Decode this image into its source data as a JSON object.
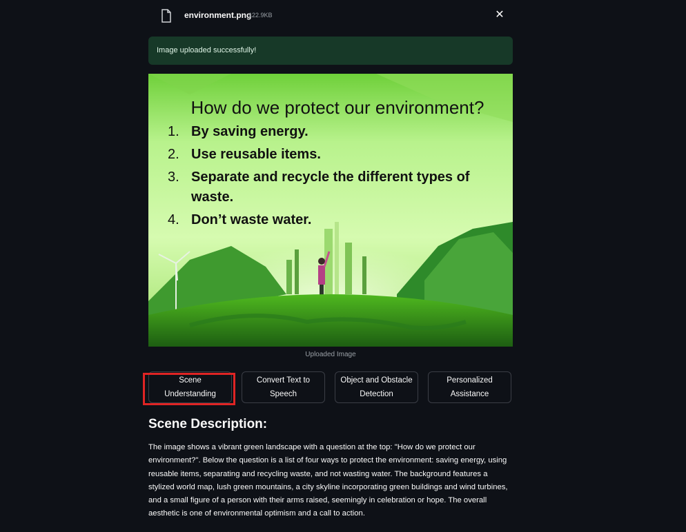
{
  "file": {
    "name": "environment.png",
    "size": "122.9KB",
    "icon": "file-icon",
    "close_icon": "close-icon"
  },
  "alert": {
    "text": "Image uploaded successfully!"
  },
  "image": {
    "title": "How do we protect our environment?",
    "items": [
      {
        "num": "1.",
        "text": "By saving energy."
      },
      {
        "num": "2.",
        "text": "Use reusable items."
      },
      {
        "num": "3.",
        "text": "Separate and recycle the different types of waste."
      },
      {
        "num": "4.",
        "text": "Don’t waste water."
      }
    ],
    "caption": "Uploaded Image"
  },
  "buttons": {
    "scene": "Scene Understanding",
    "tts": "Convert Text to Speech",
    "object": "Object and Obstacle Detection",
    "personal": "Personalized Assistance"
  },
  "result": {
    "heading": "Scene Description:",
    "text": "The image shows a vibrant green landscape with a question at the top: \"How do we protect our environment?\". Below the question is a list of four ways to protect the environment: saving energy, using reusable items, separating and recycling waste, and not wasting water. The background features a stylized world map, lush green mountains, a city skyline incorporating green buildings and wind turbines, and a small figure of a person with their arms raised, seemingly in celebration or hope. The overall aesthetic is one of environmental optimism and a call to action."
  },
  "colors": {
    "background": "#0e1117",
    "success_bg": "#173928",
    "highlight": "#e02424"
  }
}
